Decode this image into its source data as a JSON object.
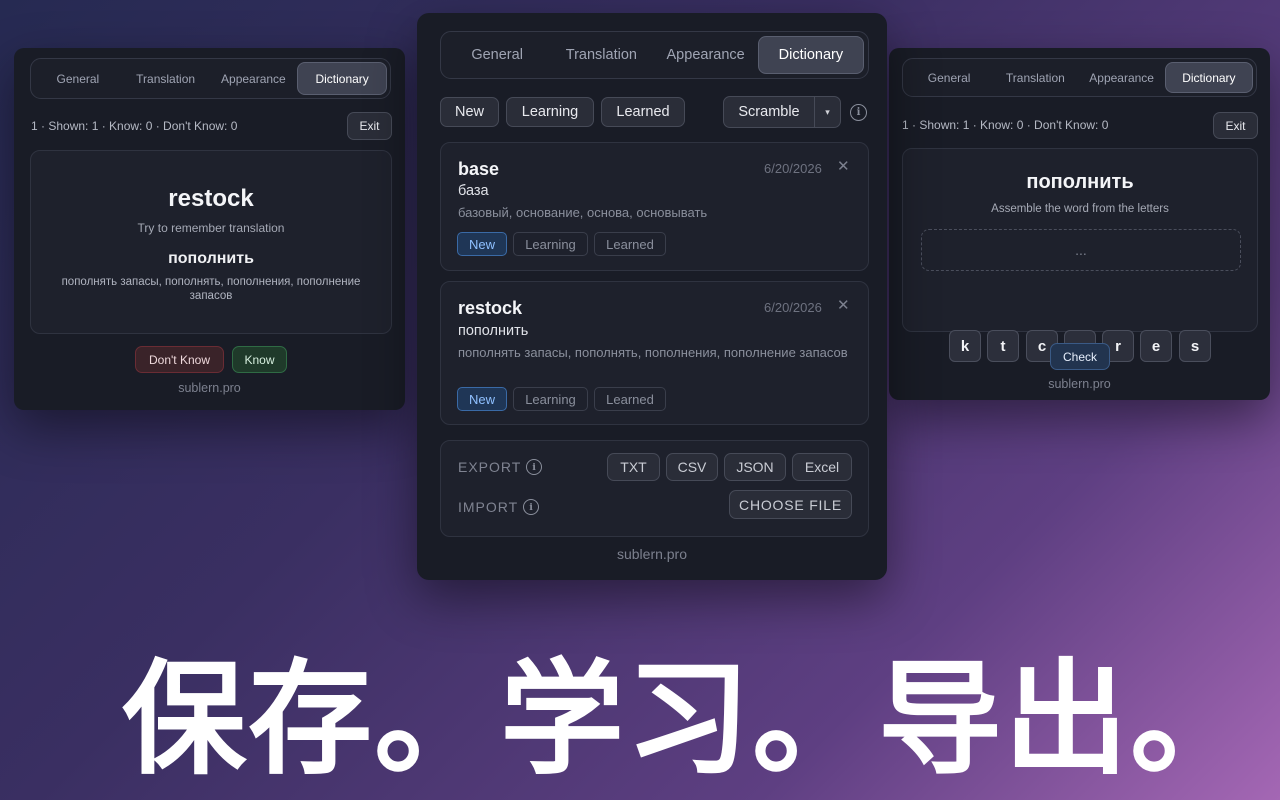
{
  "tabs": [
    "General",
    "Translation",
    "Appearance",
    "Dictionary"
  ],
  "left": {
    "stats": "1 · Shown: 1 · Know: 0 · Don't Know: 0",
    "exit_label": "Exit",
    "word": "restock",
    "hint": "Try to remember translation",
    "translation": "пополнить",
    "synonyms": "пополнять запасы, пополнять, пополнения, пополнение запасов",
    "dont_know_label": "Don't Know",
    "know_label": "Know",
    "footer": "sublern.pro"
  },
  "center": {
    "filters": [
      "New",
      "Learning",
      "Learned"
    ],
    "mode_label": "Scramble",
    "entries": [
      {
        "word": "base",
        "date": "6/20/2026",
        "translation": "база",
        "synonyms": "базовый, основание, основа, основывать",
        "statuses": [
          "New",
          "Learning",
          "Learned"
        ]
      },
      {
        "word": "restock",
        "date": "6/20/2026",
        "translation": "пополнить",
        "synonyms": "пополнять запасы, пополнять, пополнения, пополнение запасов",
        "statuses": [
          "New",
          "Learning",
          "Learned"
        ]
      }
    ],
    "export_label": "EXPORT",
    "import_label": "IMPORT",
    "formats": [
      "TXT",
      "CSV",
      "JSON",
      "Excel"
    ],
    "choose_file_label": "CHOOSE FILE",
    "footer": "sublern.pro"
  },
  "right": {
    "stats": "1 · Shown: 1 · Know: 0 · Don't Know: 0",
    "exit_label": "Exit",
    "word": "пополнить",
    "hint": "Assemble the word from the letters",
    "answer_placeholder": "...",
    "letters": [
      "k",
      "t",
      "c",
      "o",
      "r",
      "e",
      "s"
    ],
    "check_label": "Check",
    "footer": "sublern.pro"
  },
  "caption": "保存。学习。导出。",
  "icons": {
    "close": "close-icon",
    "info": "info-icon",
    "dropdown": "chevron-down-icon"
  },
  "colors": {
    "new_badge": "#8fc0ff",
    "know": "#2f6b44",
    "dont_know": "#6a2c34"
  }
}
